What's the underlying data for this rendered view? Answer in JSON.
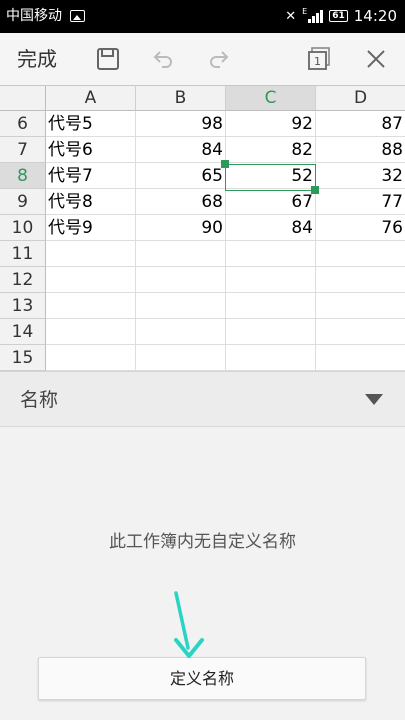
{
  "status_bar": {
    "carrier": "中国移动",
    "network_type": "E",
    "battery": "61",
    "time": "14:20"
  },
  "toolbar": {
    "done_label": "完成",
    "icons": [
      "save-icon",
      "undo-icon",
      "redo-icon",
      "sheet-switch-icon",
      "close-icon"
    ],
    "sheet_count": "1"
  },
  "sheet": {
    "columns": [
      "A",
      "B",
      "C",
      "D"
    ],
    "selected_column": "C",
    "selected_row": "8",
    "rows": [
      {
        "num": "6",
        "cells": [
          "代号5",
          "98",
          "92",
          "87"
        ]
      },
      {
        "num": "7",
        "cells": [
          "代号6",
          "84",
          "82",
          "88"
        ]
      },
      {
        "num": "8",
        "cells": [
          "代号7",
          "65",
          "52",
          "32"
        ]
      },
      {
        "num": "9",
        "cells": [
          "代号8",
          "68",
          "67",
          "77"
        ]
      },
      {
        "num": "10",
        "cells": [
          "代号9",
          "90",
          "84",
          "76"
        ]
      },
      {
        "num": "11",
        "cells": [
          "",
          "",
          "",
          ""
        ]
      },
      {
        "num": "12",
        "cells": [
          "",
          "",
          "",
          ""
        ]
      },
      {
        "num": "13",
        "cells": [
          "",
          "",
          "",
          ""
        ]
      },
      {
        "num": "14",
        "cells": [
          "",
          "",
          "",
          ""
        ]
      },
      {
        "num": "15",
        "cells": [
          "",
          "",
          "",
          ""
        ]
      }
    ]
  },
  "name_panel": {
    "title": "名称",
    "empty_message": "此工作簿内无自定义名称",
    "define_button": "定义名称"
  },
  "colors": {
    "accent": "#2c9a5a",
    "annotation_arrow": "#2ad4c4"
  }
}
